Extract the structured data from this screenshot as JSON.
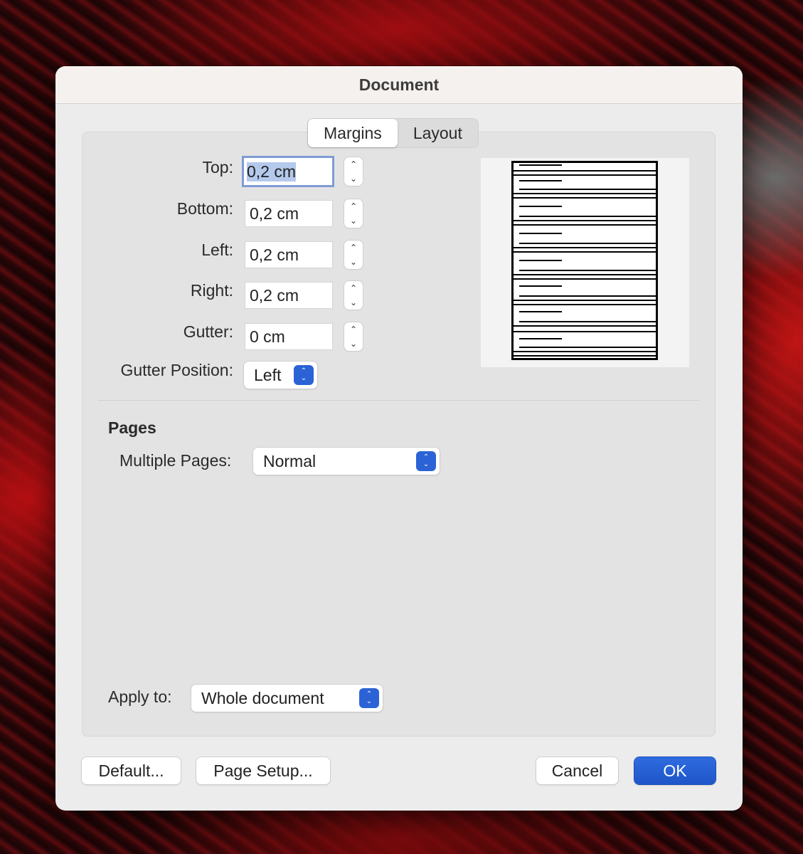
{
  "window": {
    "title": "Document"
  },
  "tabs": [
    {
      "label": "Margins",
      "active": true
    },
    {
      "label": "Layout",
      "active": false
    }
  ],
  "margins": {
    "top": {
      "label": "Top:",
      "value": "0,2 cm"
    },
    "bottom": {
      "label": "Bottom:",
      "value": "0,2 cm"
    },
    "left": {
      "label": "Left:",
      "value": "0,2 cm"
    },
    "right": {
      "label": "Right:",
      "value": "0,2 cm"
    },
    "gutter": {
      "label": "Gutter:",
      "value": "0 cm"
    },
    "gutter_position": {
      "label": "Gutter Position:",
      "value": "Left"
    }
  },
  "pages": {
    "title": "Pages",
    "multiple_pages": {
      "label": "Multiple Pages:",
      "value": "Normal"
    }
  },
  "apply_to": {
    "label": "Apply to:",
    "value": "Whole document"
  },
  "buttons": {
    "default": "Default...",
    "page_setup": "Page Setup...",
    "cancel": "Cancel",
    "ok": "OK"
  },
  "colors": {
    "accent": "#2b63d6",
    "focus_ring": "#7e9bd4"
  }
}
